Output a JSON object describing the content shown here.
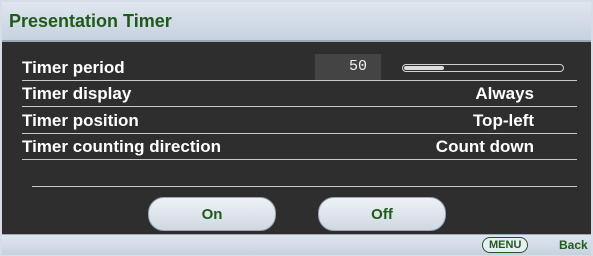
{
  "header": {
    "title": "Presentation Timer"
  },
  "rows": [
    {
      "label": "Timer period",
      "value": "50",
      "slider_fraction": 0.25
    },
    {
      "label": "Timer display",
      "value": "Always"
    },
    {
      "label": "Timer position",
      "value": "Top-left"
    },
    {
      "label": "Timer counting direction",
      "value": "Count down"
    }
  ],
  "buttons": {
    "on": "On",
    "off": "Off"
  },
  "footer": {
    "menu": "MENU",
    "back": "Back"
  },
  "colors": {
    "header_text": "#1f5a1a",
    "panel_bg": "#2e2e2e",
    "header_bg": "#dfe6ee"
  }
}
